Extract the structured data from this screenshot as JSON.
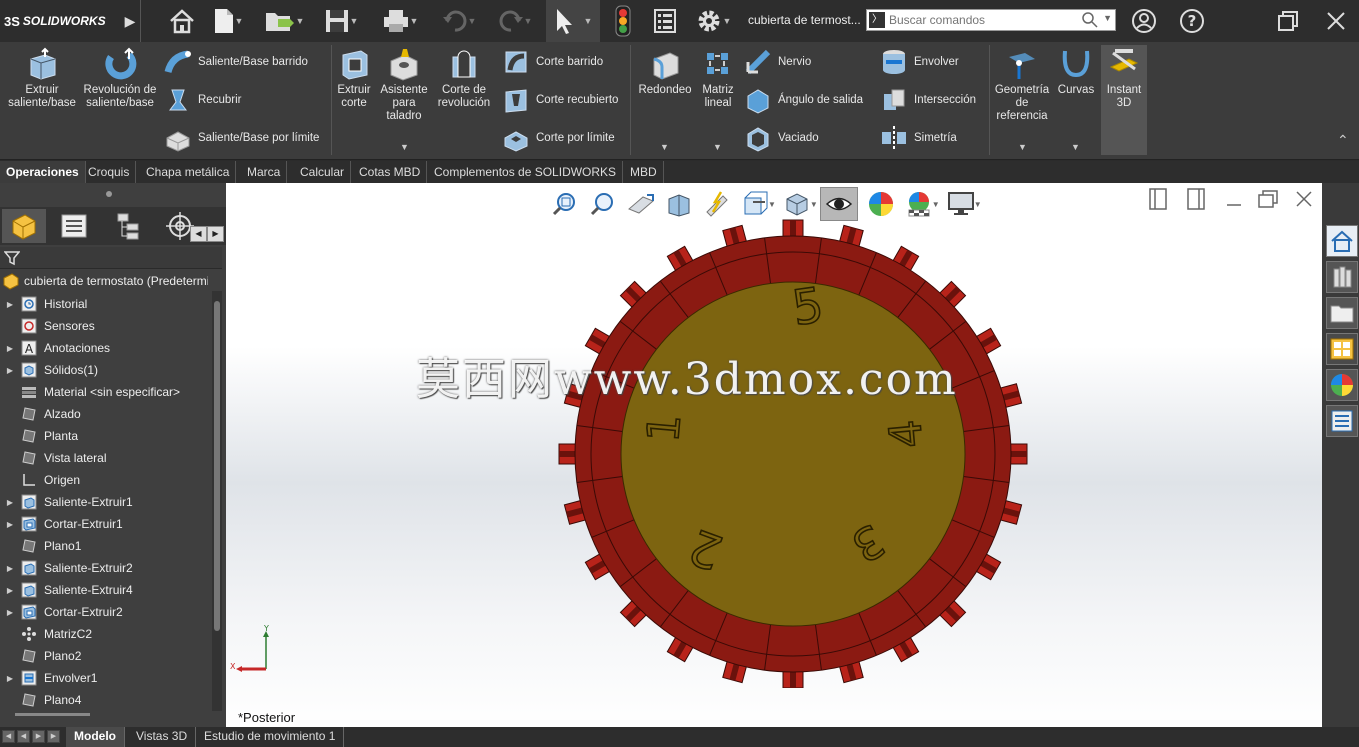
{
  "titlebar": {
    "logo_text": "SOLIDWORKS",
    "logo_mark": "3S",
    "document_title": "cubierta de termost...",
    "search_placeholder": "Buscar comandos",
    "icons": [
      "home-icon",
      "new-document-icon",
      "open-icon",
      "save-icon",
      "print-icon",
      "undo-icon",
      "redo-icon",
      "select-arrow-icon",
      "rebuild-traffic-light-icon",
      "file-properties-icon",
      "options-gear-icon",
      "search-icon",
      "user-icon",
      "help-icon",
      "restore-icon",
      "close-icon"
    ]
  },
  "ribbon": {
    "large_buttons": [
      {
        "label": "Extruir saliente/base",
        "icon": "extrude-boss-icon"
      },
      {
        "label": "Revolución de saliente/base",
        "icon": "revolve-boss-icon"
      },
      {
        "label": "Extruir corte",
        "icon": "extrude-cut-icon"
      },
      {
        "label": "Asistente para taladro",
        "icon": "hole-wizard-icon"
      },
      {
        "label": "Corte de revolución",
        "icon": "revolve-cut-icon"
      },
      {
        "label": "Redondeo",
        "icon": "fillet-icon"
      },
      {
        "label": "Matriz lineal",
        "icon": "linear-pattern-icon"
      },
      {
        "label": "Geometría de referencia",
        "icon": "reference-geometry-icon"
      },
      {
        "label": "Curvas",
        "icon": "curves-icon"
      },
      {
        "label": "Instant 3D",
        "icon": "instant3d-icon"
      }
    ],
    "small_buttons": [
      {
        "label": "Saliente/Base barrido",
        "icon": "swept-boss-icon"
      },
      {
        "label": "Recubrir",
        "icon": "loft-icon"
      },
      {
        "label": "Saliente/Base por límite",
        "icon": "boundary-boss-icon"
      },
      {
        "label": "Corte barrido",
        "icon": "swept-cut-icon"
      },
      {
        "label": "Corte recubierto",
        "icon": "lofted-cut-icon"
      },
      {
        "label": "Corte por límite",
        "icon": "boundary-cut-icon"
      },
      {
        "label": "Nervio",
        "icon": "rib-icon"
      },
      {
        "label": "Ángulo de salida",
        "icon": "draft-icon"
      },
      {
        "label": "Vaciado",
        "icon": "shell-icon"
      },
      {
        "label": "Envolver",
        "icon": "wrap-icon"
      },
      {
        "label": "Intersección",
        "icon": "intersect-icon"
      },
      {
        "label": "Simetría",
        "icon": "mirror-icon"
      }
    ]
  },
  "command_tabs": [
    "Operaciones",
    "Croquis",
    "Chapa metálica",
    "Marca",
    "Calcular",
    "Cotas MBD",
    "Complementos de SOLIDWORKS",
    "MBD"
  ],
  "active_command_tab": "Operaciones",
  "feature_tree": {
    "root": "cubierta de termostato  (Predeterminado",
    "items": [
      {
        "label": "Historial",
        "icon": "history-icon",
        "expandable": true
      },
      {
        "label": "Sensores",
        "icon": "sensors-icon",
        "expandable": false
      },
      {
        "label": "Anotaciones",
        "icon": "annotations-icon",
        "expandable": true
      },
      {
        "label": "Sólidos(1)",
        "icon": "solid-bodies-icon",
        "expandable": true
      },
      {
        "label": "Material <sin especificar>",
        "icon": "material-icon",
        "expandable": false
      },
      {
        "label": "Alzado",
        "icon": "plane-icon",
        "expandable": false
      },
      {
        "label": "Planta",
        "icon": "plane-icon",
        "expandable": false
      },
      {
        "label": "Vista lateral",
        "icon": "plane-icon",
        "expandable": false
      },
      {
        "label": "Origen",
        "icon": "origin-icon",
        "expandable": false
      },
      {
        "label": "Saliente-Extruir1",
        "icon": "extrude-feature-icon",
        "expandable": true
      },
      {
        "label": "Cortar-Extruir1",
        "icon": "cut-feature-icon",
        "expandable": true
      },
      {
        "label": "Plano1",
        "icon": "plane-icon",
        "expandable": false
      },
      {
        "label": "Saliente-Extruir2",
        "icon": "extrude-feature-icon",
        "expandable": true
      },
      {
        "label": "Saliente-Extruir4",
        "icon": "extrude-feature-icon",
        "expandable": true
      },
      {
        "label": "Cortar-Extruir2",
        "icon": "cut-feature-icon",
        "expandable": true
      },
      {
        "label": "MatrizC2",
        "icon": "circular-pattern-icon",
        "expandable": false
      },
      {
        "label": "Plano2",
        "icon": "plane-icon",
        "expandable": false
      },
      {
        "label": "Envolver1",
        "icon": "wrap-feature-icon",
        "expandable": true
      },
      {
        "label": "Plano4",
        "icon": "plane-icon",
        "expandable": false
      }
    ]
  },
  "viewport": {
    "view_name": "*Posterior",
    "watermark": "莫西网www.3dmox.com",
    "dial_numbers": [
      "1",
      "2",
      "3",
      "4",
      "5"
    ],
    "triad_labels": {
      "x": "X",
      "y": "Y"
    },
    "colors": {
      "ring": "#8b1a12",
      "ring_dark": "#6a120c",
      "tabs": "#b8231a",
      "face": "#7d6410"
    }
  },
  "bottom_tabs": [
    "Modelo",
    "Vistas 3D",
    "Estudio de movimiento 1"
  ],
  "active_bottom_tab": "Modelo"
}
